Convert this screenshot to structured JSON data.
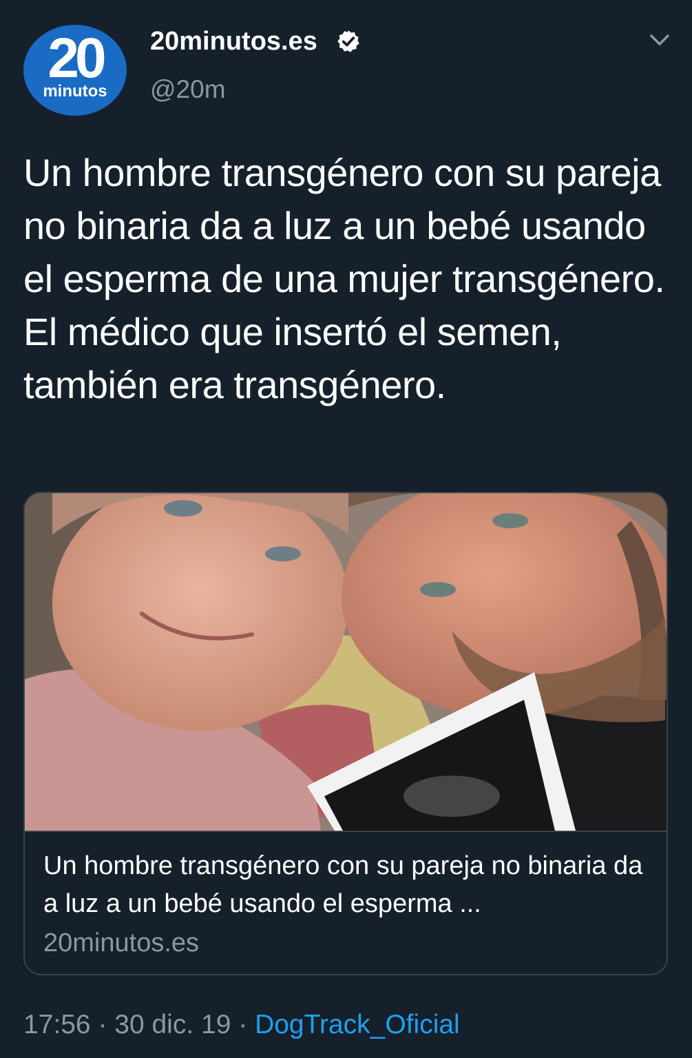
{
  "tweet": {
    "avatar": {
      "number": "20",
      "word": "minutos"
    },
    "author_name": "20minutos.es",
    "handle": "@20m",
    "text": "Un hombre transgénero con su pareja no binaria da a luz a un bebé usando el esperma de una mujer transgénero. El médico que insertó el semen, también era transgénero.",
    "card": {
      "title": "Un hombre transgénero con su pareja no binaria da a luz a un bebé usando el esperma ...",
      "domain": "20minutos.es"
    },
    "meta": {
      "time": "17:56",
      "sep1": " · ",
      "date": "30 dic. 19",
      "sep2": " · ",
      "source": "DogTrack_Oficial"
    }
  },
  "colors": {
    "background": "#15202b",
    "text_primary": "#ffffff",
    "text_secondary": "#8899a6",
    "accent": "#1da1f2",
    "border": "#38444d",
    "avatar_bg": "#1a6bc4"
  },
  "icons": {
    "verified": "verified-badge-icon",
    "menu": "chevron-down-icon"
  }
}
